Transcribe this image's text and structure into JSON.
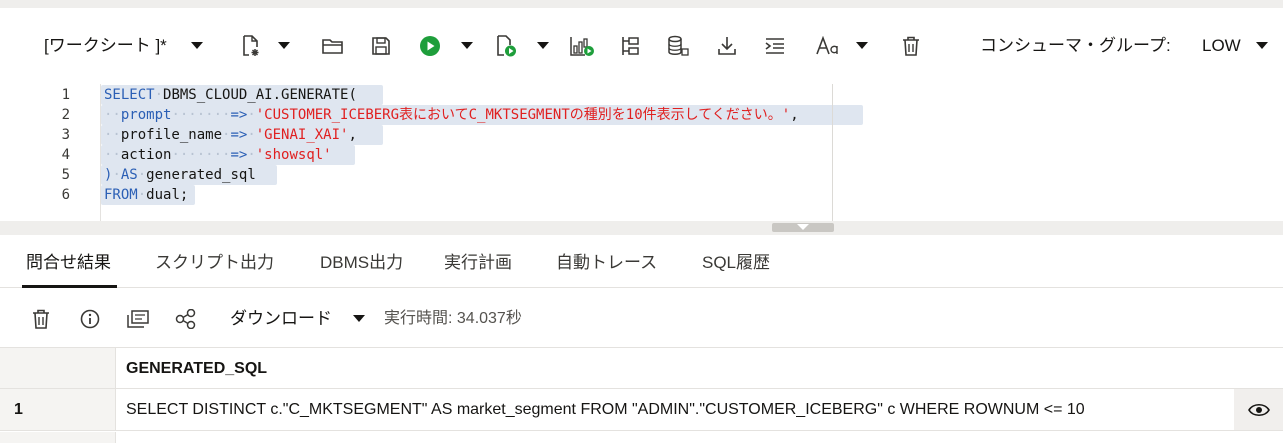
{
  "toolbar": {
    "worksheet_label": "[ワークシート ]*",
    "icons": [
      "new-file-icon",
      "open-folder-icon",
      "save-icon",
      "run-statement-icon",
      "run-script-icon",
      "explain-plan-icon",
      "autotrace-icon",
      "database-icon",
      "download-icon",
      "format-icon",
      "font-icon",
      "trash-icon"
    ],
    "consumer_group_label": "コンシューマ・グループ:",
    "consumer_group_value": "LOW",
    "run_color": "#1e9e3b"
  },
  "editor": {
    "line_numbers": [
      "1",
      "2",
      "3",
      "4",
      "5",
      "6"
    ],
    "lines": {
      "l1_kw": "SELECT",
      "l1_id": "DBMS_CLOUD_AI.GENERATE(",
      "l2_id": "prompt",
      "l2_op": "=>",
      "l2_str": "'CUSTOMER_ICEBERG表においてC_MKTSEGMENTの種別を10件表示してください。'",
      "l2_comma": ",",
      "l3_id": "profile_name",
      "l3_op": "=>",
      "l3_str": "'GENAI_XAI'",
      "l3_comma": ",",
      "l4_id": "action",
      "l4_op": "=>",
      "l4_str": "'showsql'",
      "l5_paren": ")",
      "l5_kw": "AS",
      "l5_id": "generated_sql",
      "l6_kw": "FROM",
      "l6_id": "dual;"
    },
    "keyword_color": "#2b5fb5",
    "string_color": "#e02020",
    "selection_color": "#dfe6f0"
  },
  "tabs": {
    "items": [
      "問合せ結果",
      "スクリプト出力",
      "DBMS出力",
      "実行計画",
      "自動トレース",
      "SQL履歴"
    ],
    "active": "問合せ結果"
  },
  "result_toolbar": {
    "download_label": "ダウンロード",
    "exec_time": "実行時間: 34.037秒"
  },
  "grid": {
    "column_header": "GENERATED_SQL",
    "rows": [
      {
        "num": "1",
        "value": "SELECT DISTINCT c.\"C_MKTSEGMENT\" AS market_segment FROM \"ADMIN\".\"CUSTOMER_ICEBERG\" c WHERE ROWNUM <= 10"
      }
    ]
  }
}
